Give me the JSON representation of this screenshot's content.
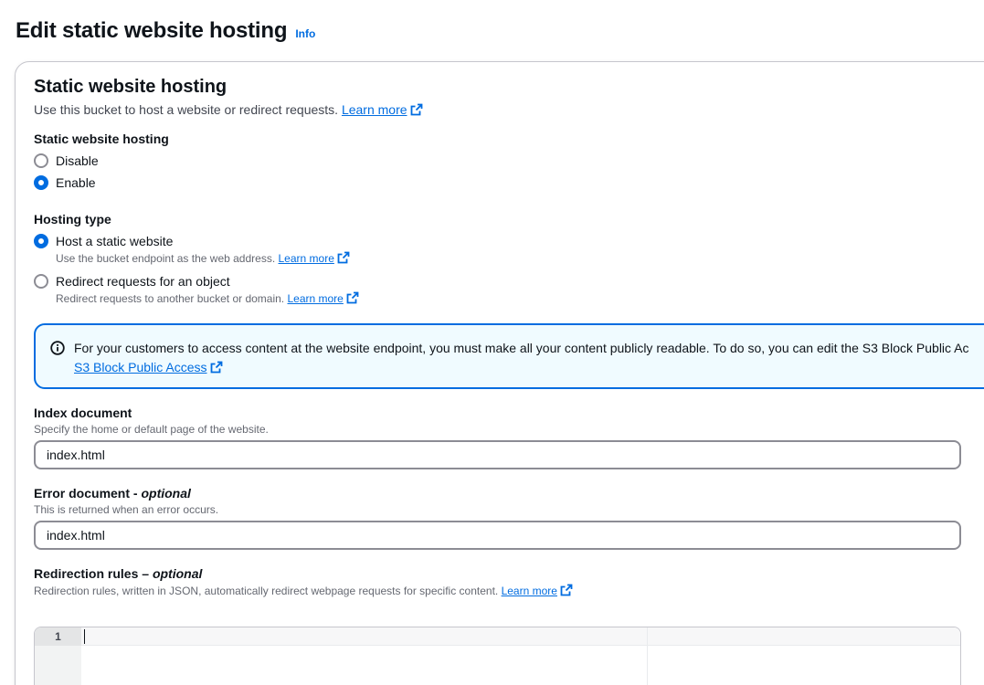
{
  "header": {
    "title": "Edit static website hosting",
    "info": "Info"
  },
  "section": {
    "title": "Static website hosting",
    "description": "Use this bucket to host a website or redirect requests.",
    "learn_more": "Learn more"
  },
  "hosting_toggle": {
    "label": "Static website hosting",
    "options": [
      {
        "label": "Disable",
        "checked": false
      },
      {
        "label": "Enable",
        "checked": true
      }
    ]
  },
  "hosting_type": {
    "label": "Hosting type",
    "options": [
      {
        "label": "Host a static website",
        "description": "Use the bucket endpoint as the web address.",
        "learn_more": "Learn more",
        "checked": true
      },
      {
        "label": "Redirect requests for an object",
        "description": "Redirect requests to another bucket or domain.",
        "learn_more": "Learn more",
        "checked": false
      }
    ]
  },
  "alert": {
    "text": "For your customers to access content at the website endpoint, you must make all your content publicly readable. To do so, you can edit the S3 Block Public Ac",
    "link": "S3 Block Public Access"
  },
  "index_document": {
    "label": "Index document",
    "description": "Specify the home or default page of the website.",
    "value": "index.html"
  },
  "error_document": {
    "label": "Error document - ",
    "label_optional": "optional",
    "description": "This is returned when an error occurs.",
    "value": "index.html"
  },
  "redirection_rules": {
    "label": "Redirection rules – ",
    "label_optional": "optional",
    "description": "Redirection rules, written in JSON, automatically redirect webpage requests for specific content.",
    "learn_more": "Learn more",
    "line_number": "1"
  },
  "colors": {
    "accent": "#006ce0",
    "alert_bg": "#f0fbff",
    "text": "#0f141a"
  }
}
